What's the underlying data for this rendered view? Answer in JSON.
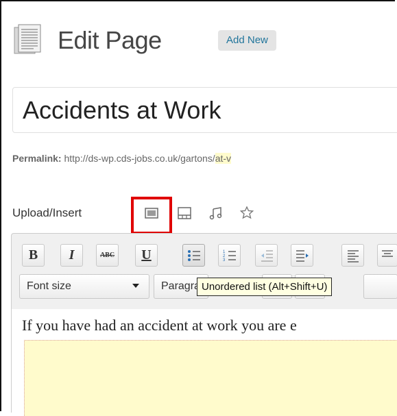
{
  "header": {
    "title": "Edit Page",
    "add_new_label": "Add New"
  },
  "title_field": {
    "value": "Accidents at Work"
  },
  "permalink": {
    "label": "Permalink:",
    "url": "http://ds-wp.cds-jobs.co.uk/gartons/",
    "url_highlight": "at-v"
  },
  "upload": {
    "label": "Upload/Insert",
    "icons": [
      "add-image-icon",
      "add-video-icon",
      "add-audio-icon",
      "add-media-icon"
    ]
  },
  "toolbar": {
    "bold": "B",
    "italic": "I",
    "strikethrough": "ABC",
    "underline": "U",
    "font_size_label": "Font size",
    "paragraph_label": "Paragraph"
  },
  "tooltip": {
    "text": "Unordered list (Alt+Shift+U)"
  },
  "content": {
    "first_line": "If you have had an accident at work you are e"
  },
  "colors": {
    "link": "#21759b",
    "highlight": "#e00000",
    "tooltip_bg": "#ffffe1",
    "content_highlight": "#fffbcc"
  }
}
